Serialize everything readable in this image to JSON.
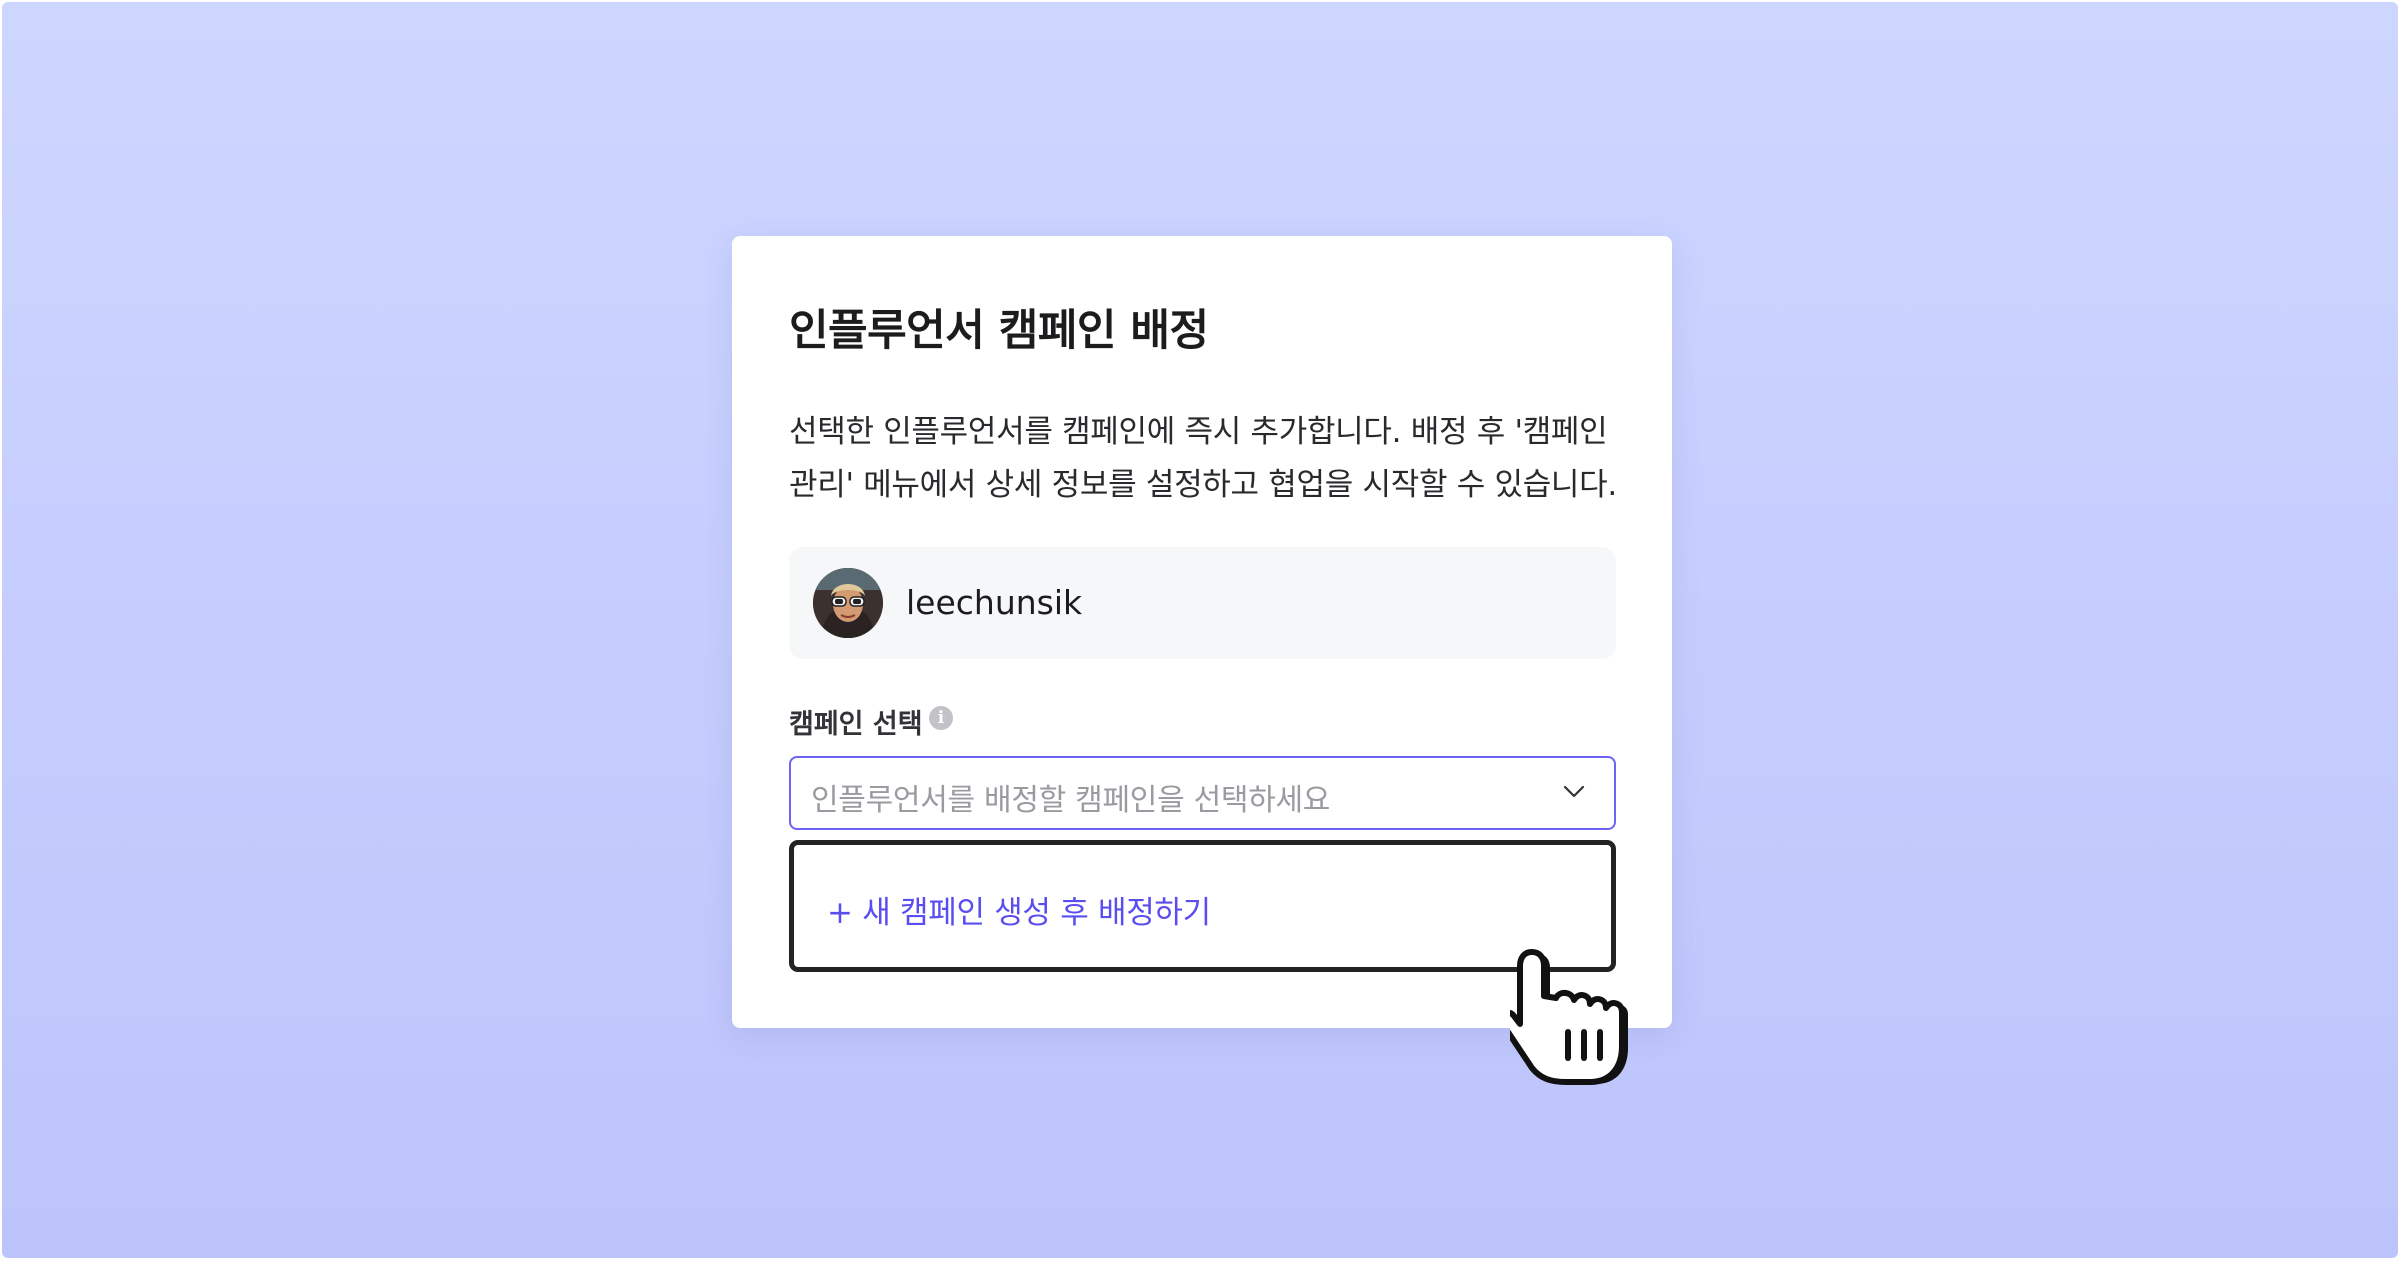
{
  "modal": {
    "title": "인플루언서 캠페인 배정",
    "description": "선택한 인플루언서를 캠페인에 즉시 추가합니다. 배정 후 '캠페인 관리' 메뉴에서 상세 정보를 설정하고 협업을 시작할 수 있습니다."
  },
  "influencer": {
    "username": "leechunsik",
    "avatar": "profile-photo"
  },
  "campaign_field": {
    "label": "캠페인 선택",
    "info_icon": "i",
    "placeholder": "인플루언서를 배정할 캠페인을 선택하세요"
  },
  "dropdown": {
    "create_option": "+ 새 캠페인 생성 후 배정하기"
  },
  "colors": {
    "accent": "#6d63f4",
    "option_text": "#5a4ef0",
    "background_top": "#cdd6ff",
    "background_bottom": "#bcc4fb"
  }
}
